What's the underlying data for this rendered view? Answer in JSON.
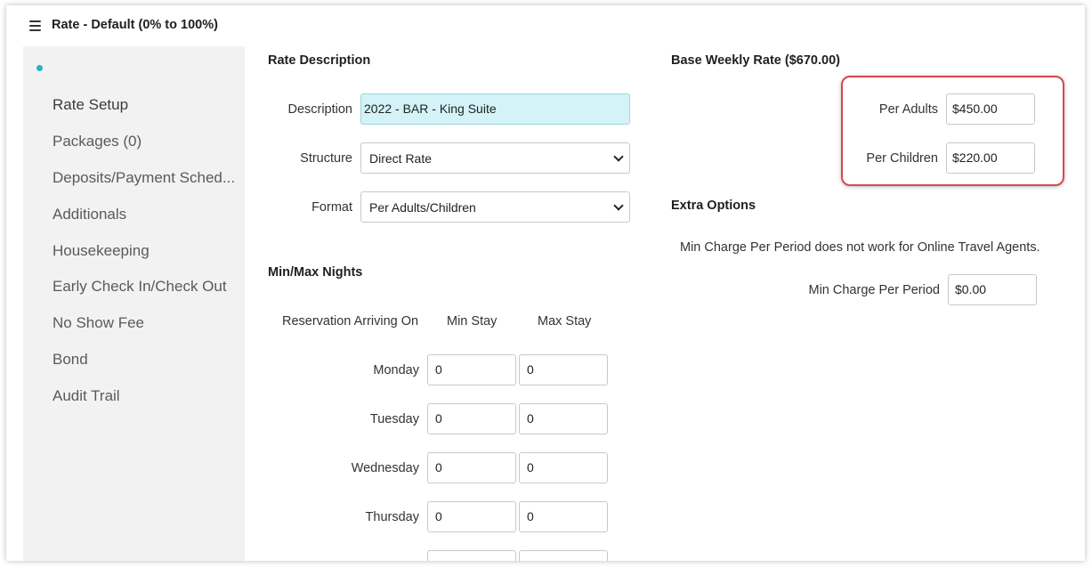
{
  "header": {
    "title": "Rate - Default (0% to 100%)",
    "menu_icon": "hamburger-icon"
  },
  "sidebar": {
    "items": [
      {
        "label": "Rate Setup",
        "active": true
      },
      {
        "label": "Packages (0)"
      },
      {
        "label": "Deposits/Payment Sched..."
      },
      {
        "label": "Additionals"
      },
      {
        "label": "Housekeeping"
      },
      {
        "label": "Early Check In/Check Out"
      },
      {
        "label": "No Show Fee"
      },
      {
        "label": "Bond"
      },
      {
        "label": "Audit Trail"
      }
    ],
    "accent": "#23b5c8"
  },
  "rate_description": {
    "title": "Rate Description",
    "description_label": "Description",
    "description_value": "2022 - BAR - King Suite",
    "structure_label": "Structure",
    "structure_value": "Direct Rate",
    "format_label": "Format",
    "format_value": "Per Adults/Children"
  },
  "base_rate": {
    "title": "Base Weekly Rate ($670.00)",
    "adults_label": "Per Adults",
    "adults_value": "$450.00",
    "children_label": "Per Children",
    "children_value": "$220.00",
    "highlight_color": "#d9474f"
  },
  "extra_options": {
    "title": "Extra Options",
    "note": "Min Charge Per Period does not work for Online Travel Agents.",
    "min_charge_label": "Min Charge Per Period",
    "min_charge_value": "$0.00"
  },
  "min_max": {
    "title": "Min/Max Nights",
    "col_arriving": "Reservation Arriving On",
    "col_min": "Min Stay",
    "col_max": "Max Stay",
    "rows": [
      {
        "day": "Monday",
        "min": "0",
        "max": "0"
      },
      {
        "day": "Tuesday",
        "min": "0",
        "max": "0"
      },
      {
        "day": "Wednesday",
        "min": "0",
        "max": "0"
      },
      {
        "day": "Thursday",
        "min": "0",
        "max": "0"
      }
    ]
  }
}
